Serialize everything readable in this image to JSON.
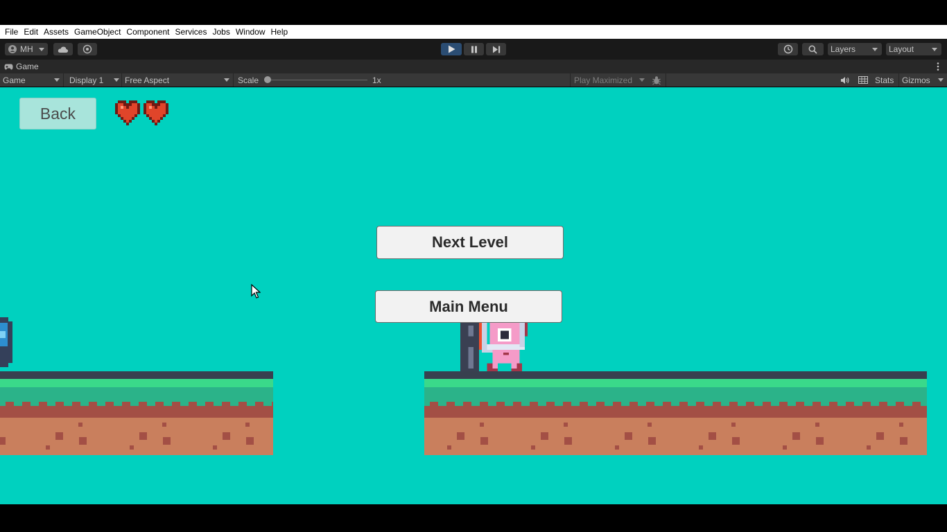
{
  "menubar": {
    "items": [
      "File",
      "Edit",
      "Assets",
      "GameObject",
      "Component",
      "Services",
      "Jobs",
      "Window",
      "Help"
    ]
  },
  "toolbar": {
    "account_label": "MH",
    "layers_label": "Layers",
    "layout_label": "Layout",
    "icons": [
      "account-icon",
      "cloud-icon",
      "collab-icon",
      "play-icon",
      "pause-icon",
      "step-icon",
      "history-icon",
      "search-icon"
    ]
  },
  "game_tab": {
    "title": "Game"
  },
  "game_view_bar": {
    "mode": "Game",
    "display": "Display 1",
    "aspect": "Free Aspect",
    "scale_label": "Scale",
    "scale_value": "1x",
    "scale_level": 0,
    "play_mode": "Play Maximized",
    "stats": "Stats",
    "gizmos": "Gizmos"
  },
  "game": {
    "back_label": "Back",
    "hearts_count": 2,
    "next_level_label": "Next Level",
    "main_menu_label": "Main Menu",
    "colors": {
      "sky": "#00d1bf",
      "grass": "#3ad98a",
      "grass_dark": "#2bb389",
      "dirt": "#c97f5d",
      "dirt_edge": "#a34f45",
      "platform_top": "#38404f",
      "heart": "#e0452a"
    }
  }
}
